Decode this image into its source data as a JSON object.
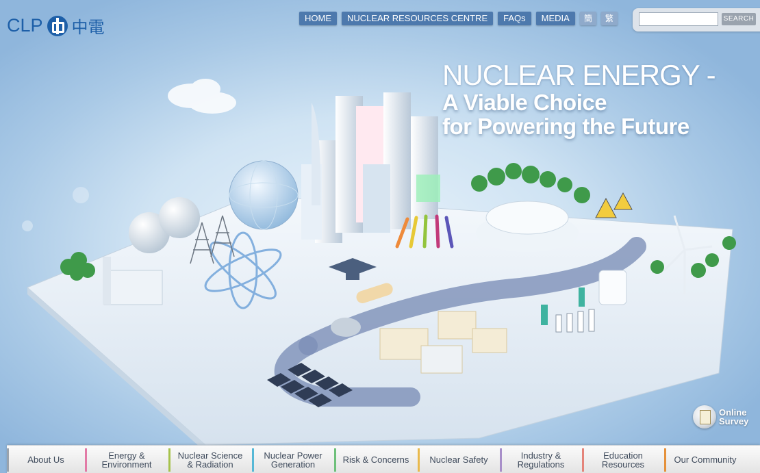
{
  "logo": {
    "text": "CLP",
    "cn_text": "中電"
  },
  "top_nav": {
    "items": [
      "HOME",
      "NUCLEAR RESOURCES CENTRE",
      "FAQs",
      "MEDIA"
    ],
    "lang": [
      "簡",
      "繁"
    ]
  },
  "search": {
    "placeholder": "",
    "button_label": "SEARCH"
  },
  "headline": {
    "line1": "NUCLEAR ENERGY -",
    "line2": "A Viable Choice",
    "line3": "for Powering the Future"
  },
  "survey": {
    "line1": "Online",
    "line2": "Survey"
  },
  "bottom_nav": {
    "items": [
      {
        "line1": "About Us",
        "line2": "",
        "color": "#9aa3ad"
      },
      {
        "line1": "Energy &",
        "line2": "Environment",
        "color": "#e27aa6"
      },
      {
        "line1": "Nuclear Science",
        "line2": "& Radiation",
        "color": "#a6c24b"
      },
      {
        "line1": "Nuclear Power",
        "line2": "Generation",
        "color": "#56b8d6"
      },
      {
        "line1": "Risk & Concerns",
        "line2": "",
        "color": "#6ec07a"
      },
      {
        "line1": "Nuclear Safety",
        "line2": "",
        "color": "#e9b94c"
      },
      {
        "line1": "Industry &",
        "line2": "Regulations",
        "color": "#a88fc9"
      },
      {
        "line1": "Education",
        "line2": "Resources",
        "color": "#e4847a"
      },
      {
        "line1": "Our Community",
        "line2": "",
        "color": "#e5913b"
      }
    ]
  },
  "colors": {
    "brand_blue": "#1d5fa8",
    "nav_blue": "#4d79ad",
    "sky": "#a9c9e6"
  }
}
